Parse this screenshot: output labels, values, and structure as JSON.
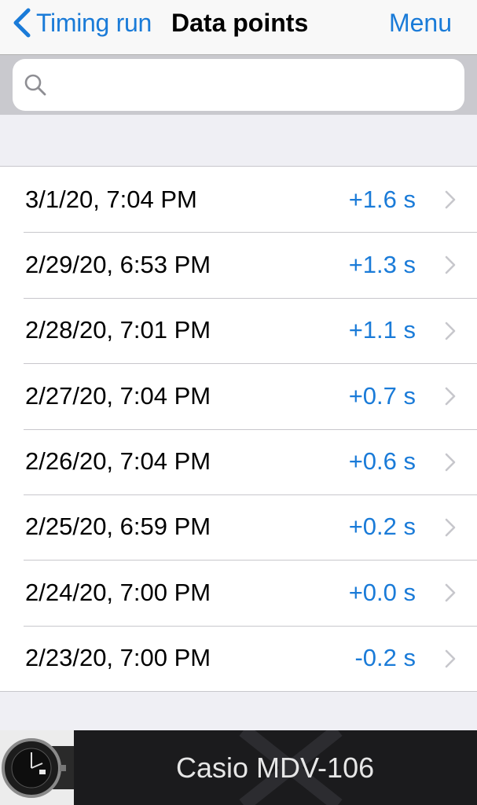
{
  "nav": {
    "back_label": "Timing run",
    "title": "Data points",
    "menu_label": "Menu"
  },
  "search": {
    "value": "",
    "icon": "search-icon"
  },
  "rows": [
    {
      "date": "3/1/20, 7:04 PM",
      "value": "+1.6 s"
    },
    {
      "date": "2/29/20, 6:53 PM",
      "value": "+1.3 s"
    },
    {
      "date": "2/28/20, 7:01 PM",
      "value": "+1.1 s"
    },
    {
      "date": "2/27/20, 7:04 PM",
      "value": "+0.7 s"
    },
    {
      "date": "2/26/20, 7:04 PM",
      "value": "+0.6 s"
    },
    {
      "date": "2/25/20, 6:59 PM",
      "value": "+0.2 s"
    },
    {
      "date": "2/24/20, 7:00 PM",
      "value": "+0.0 s"
    },
    {
      "date": "2/23/20, 7:00 PM",
      "value": "-0.2 s"
    }
  ],
  "footer": {
    "watch_name": "Casio MDV-106"
  },
  "colors": {
    "accent": "#1a7bd8",
    "background": "#efeff4",
    "footer_bg": "#1b1b1d"
  }
}
